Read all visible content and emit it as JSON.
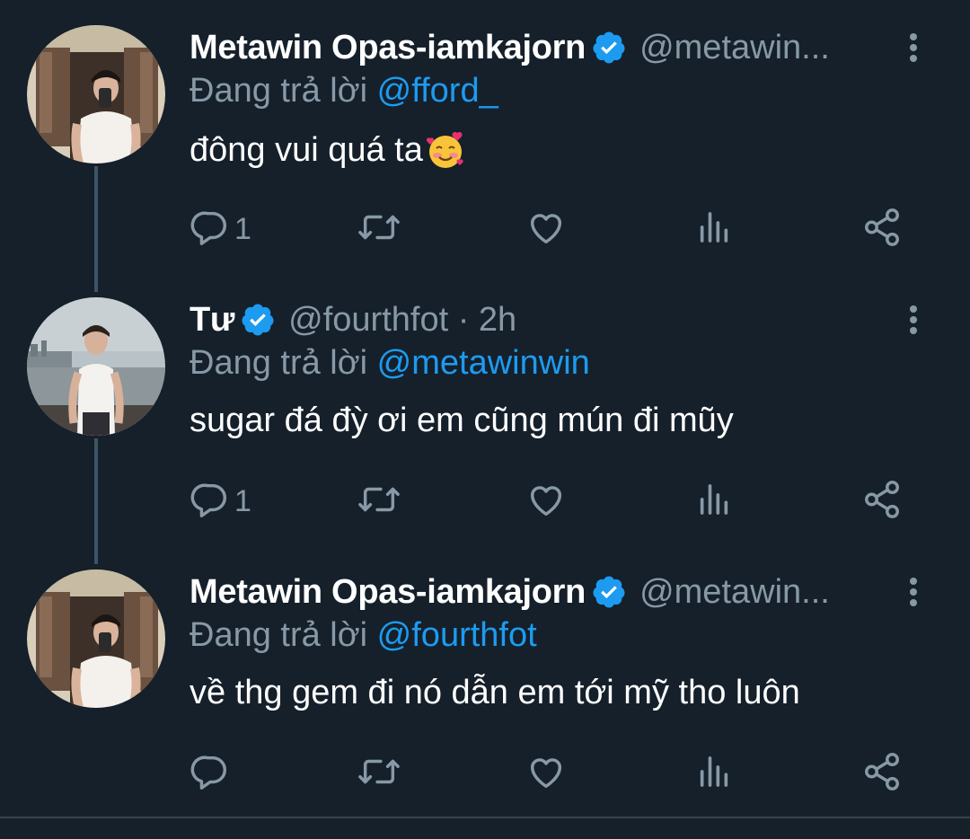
{
  "colors": {
    "background": "#15202b",
    "primary_text": "#ffffff",
    "secondary_text": "#8899a6",
    "accent": "#1d9bf0",
    "thread_line": "#3d5466"
  },
  "tweets": [
    {
      "name": "Metawin Opas-iamkajorn",
      "verified": true,
      "handle": "@metawin...",
      "reply_prefix": "Đang trả lời",
      "reply_mention": "@fford_",
      "text": "đông vui quá ta",
      "emoji": "smiling-face-with-hearts",
      "reply_count": "1",
      "icons": [
        "reply-icon",
        "retweet-icon",
        "like-icon",
        "analytics-icon",
        "share-icon"
      ]
    },
    {
      "name": "Tư",
      "verified": true,
      "handle": "@fourthfot · 2h",
      "reply_prefix": "Đang trả lời",
      "reply_mention": "@metawinwin",
      "text": "sugar đá đỳ ơi em cũng mún đi mũy",
      "reply_count": "1",
      "icons": [
        "reply-icon",
        "retweet-icon",
        "like-icon",
        "analytics-icon",
        "share-icon"
      ]
    },
    {
      "name": "Metawin Opas-iamkajorn",
      "verified": true,
      "handle": "@metawin...",
      "reply_prefix": "Đang trả lời",
      "reply_mention": "@fourthfot",
      "text": "về thg gem đi nó dẫn em tới mỹ tho luôn",
      "reply_count": "",
      "icons": [
        "reply-icon",
        "retweet-icon",
        "like-icon",
        "analytics-icon",
        "share-icon"
      ]
    }
  ]
}
